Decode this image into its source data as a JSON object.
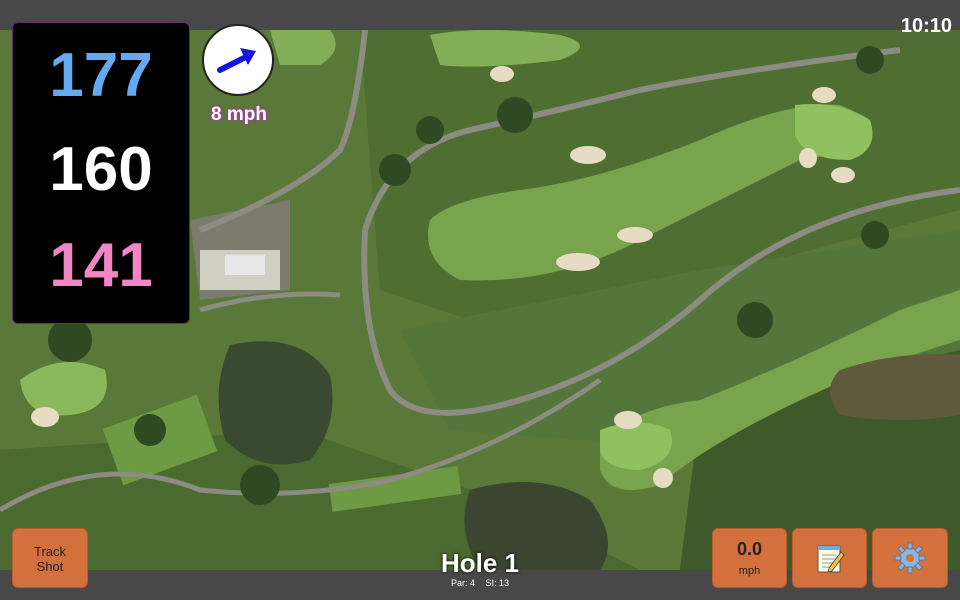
{
  "status": {
    "clock": "10:10"
  },
  "distances": {
    "back": "177",
    "center": "160",
    "front": "141",
    "back_color": "#64aaf0",
    "center_color": "#ffffff",
    "front_color": "#f086c4"
  },
  "wind": {
    "speed_label": "8 mph",
    "direction_icon": "wind-arrow-icon"
  },
  "buttons": {
    "track_shot": "Track Shot",
    "wind_value": "0.0",
    "wind_unit": "mph",
    "notes_icon": "notepad-icon",
    "settings_icon": "gear-icon",
    "accent": "#d4703c"
  },
  "hole": {
    "title": "Hole 1",
    "par": "Par: 4",
    "si": "SI: 13"
  }
}
